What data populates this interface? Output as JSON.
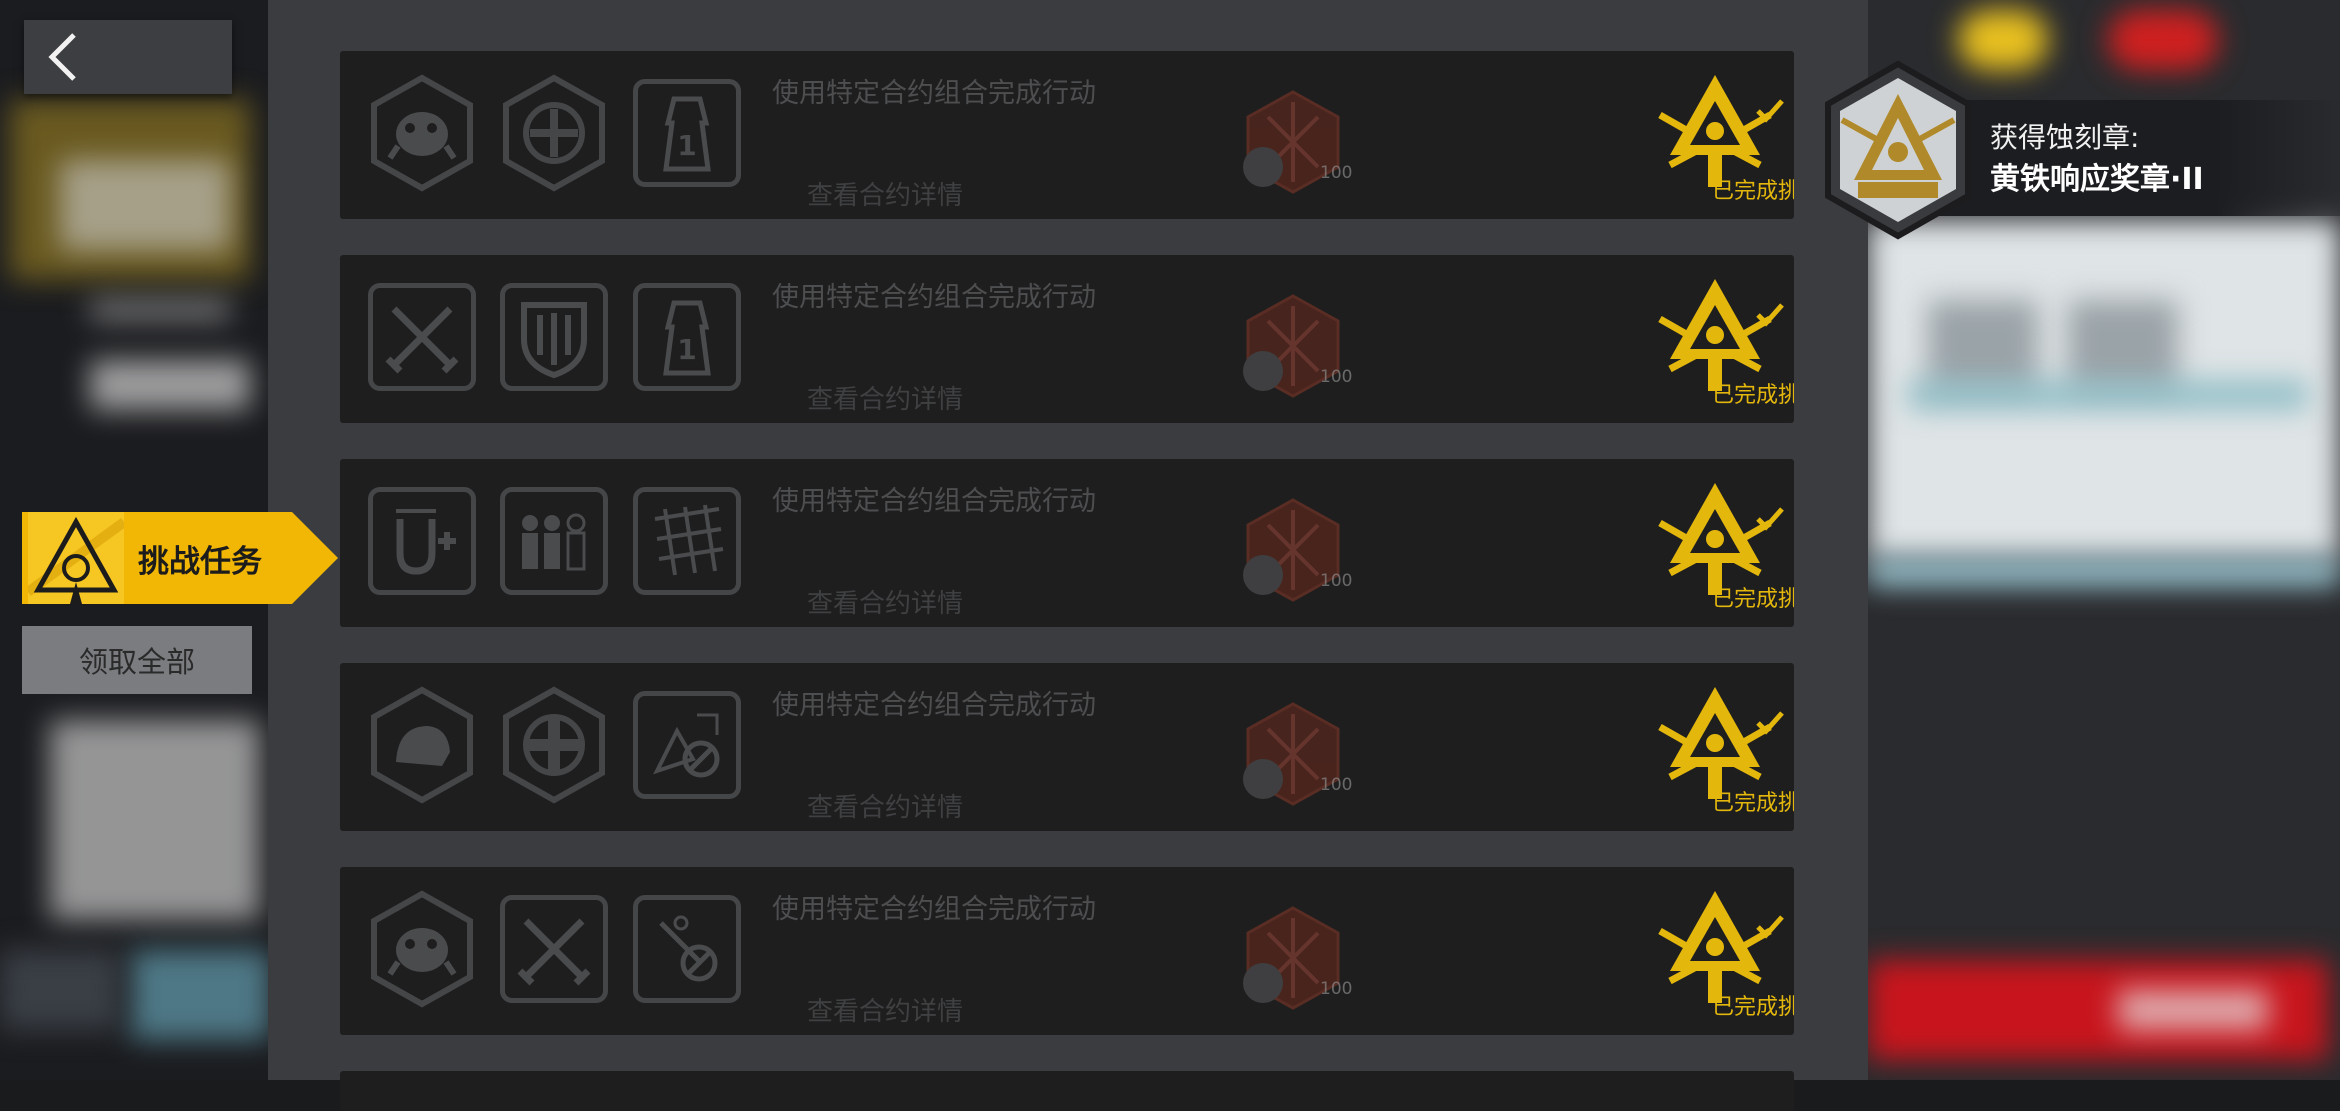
{
  "nav": {
    "back_icon": "chevron-left-icon",
    "challenge_tab_label": "挑战任务",
    "claim_all_label": "领取全部"
  },
  "tasks": [
    {
      "title": "使用特定合约组合完成行动",
      "link": "查看合约详情",
      "reward_count": "100",
      "status": "已完成挑战",
      "icons": [
        "crab-creature-hex-icon",
        "hex-crosshair-icon",
        "tower-1-icon"
      ]
    },
    {
      "title": "使用特定合约组合完成行动",
      "link": "查看合约详情",
      "reward_count": "100",
      "status": "已完成挑战",
      "icons": [
        "crossed-swords-icon",
        "shield-icon",
        "tower-1-icon"
      ]
    },
    {
      "title": "使用特定合约组合完成行动",
      "link": "查看合约详情",
      "reward_count": "100",
      "status": "已完成挑战",
      "icons": [
        "u-plus-icon",
        "people-group-icon",
        "grid-map-icon"
      ]
    },
    {
      "title": "使用特定合约组合完成行动",
      "link": "查看合约详情",
      "reward_count": "100",
      "status": "已完成挑战",
      "icons": [
        "hex-creature-icon",
        "hex-cross-icon",
        "no-terrain-icon"
      ]
    },
    {
      "title": "使用特定合约组合完成行动",
      "link": "查看合约详情",
      "reward_count": "100",
      "status": "已完成挑战",
      "icons": [
        "crab-creature-hex-icon",
        "crossed-swords-icon",
        "no-arrow-icon"
      ]
    }
  ],
  "toast": {
    "line1": "获得蚀刻章:",
    "line2": "黄铁响应奖章·II",
    "medal_icon": "pyrite-medal-icon"
  },
  "colors": {
    "accent_yellow": "#f2b705",
    "complete_gold": "#e4b70d",
    "card_bg": "#1e1e1f",
    "panel_bg": "#3b3c3f"
  }
}
